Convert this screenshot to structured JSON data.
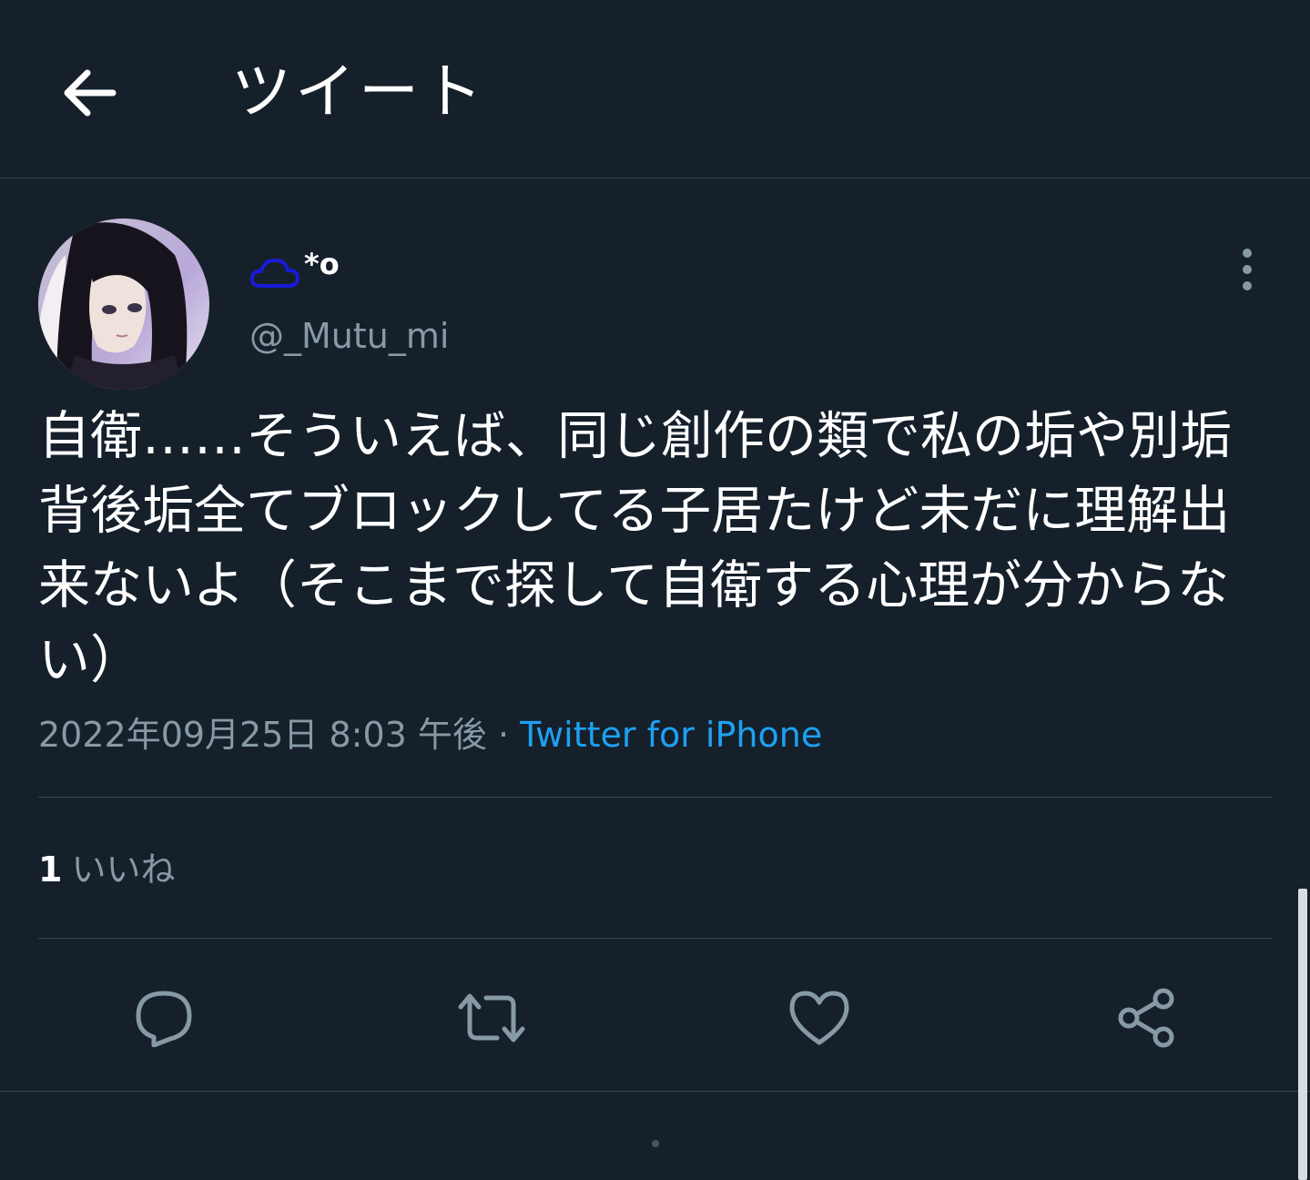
{
  "header": {
    "title": "ツイート",
    "back_icon": "arrow-left-icon"
  },
  "author": {
    "display_name": "*o",
    "display_name_icon": "cloud-icon",
    "handle": "@_Mutu_mi"
  },
  "tweet": {
    "text": "自衛……そういえば、同じ創作の類で私の垢や別垢背後垢全てブロックしてる子居たけど未だに理解出来ないよ（そこまで探して自衛する心理が分からない）",
    "timestamp": "2022年09月25日 8:03 午後",
    "separator": " · ",
    "source": "Twitter for iPhone"
  },
  "stats": {
    "likes_count": "1",
    "likes_label": "いいね"
  },
  "actions": {
    "reply_icon": "reply-icon",
    "retweet_icon": "retweet-icon",
    "like_icon": "heart-icon",
    "share_icon": "share-icon"
  },
  "colors": {
    "background": "#15202b",
    "divider": "#38444d",
    "secondary_text": "#8899a6",
    "link": "#1da1f2",
    "cloud_icon": "#1a1ad6"
  }
}
